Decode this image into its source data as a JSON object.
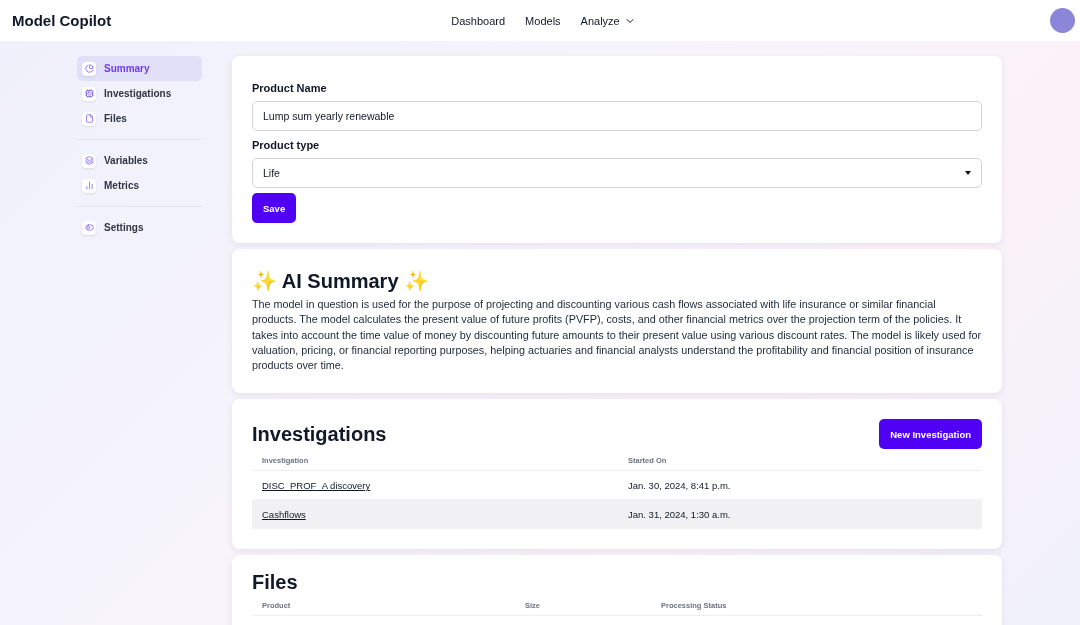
{
  "header": {
    "brand": "Model Copilot",
    "nav": [
      {
        "label": "Dashboard",
        "dropdown": false
      },
      {
        "label": "Models",
        "dropdown": false
      },
      {
        "label": "Analyze",
        "dropdown": true
      }
    ]
  },
  "sidebar": {
    "groups": [
      [
        {
          "label": "Summary",
          "selected": true
        },
        {
          "label": "Investigations",
          "selected": false
        },
        {
          "label": "Files",
          "selected": false
        }
      ],
      [
        {
          "label": "Variables",
          "selected": false
        },
        {
          "label": "Metrics",
          "selected": false
        }
      ],
      [
        {
          "label": "Settings",
          "selected": false
        }
      ]
    ]
  },
  "product_form": {
    "name_label": "Product Name",
    "name_value": "Lump sum yearly renewable",
    "type_label": "Product type",
    "type_value": "Life",
    "save": "Save"
  },
  "ai_summary": {
    "title": "✨ AI Summary ✨",
    "text": "The model in question is used for the purpose of projecting and discounting various cash flows associated with life insurance or similar financial products. The model calculates the present value of future profits (PVFP), costs, and other financial metrics over the projection term of the policies. It takes into account the time value of money by discounting future amounts to their present value using various discount rates. The model is likely used for valuation, pricing, or financial reporting purposes, helping actuaries and financial analysts understand the profitability and financial position of insurance products over time."
  },
  "investigations": {
    "title": "Investigations",
    "new_button": "New Investigation",
    "columns": [
      "Investigation",
      "Started On"
    ],
    "rows": [
      {
        "name": "DISC_PROF_A discovery",
        "started": "Jan. 30, 2024, 8:41 p.m.",
        "highlighted": false
      },
      {
        "name": "Cashflows",
        "started": "Jan. 31, 2024, 1:30 a.m.",
        "highlighted": true
      }
    ]
  },
  "files": {
    "title": "Files",
    "columns": [
      "Product",
      "Size",
      "Processing Status"
    ]
  }
}
